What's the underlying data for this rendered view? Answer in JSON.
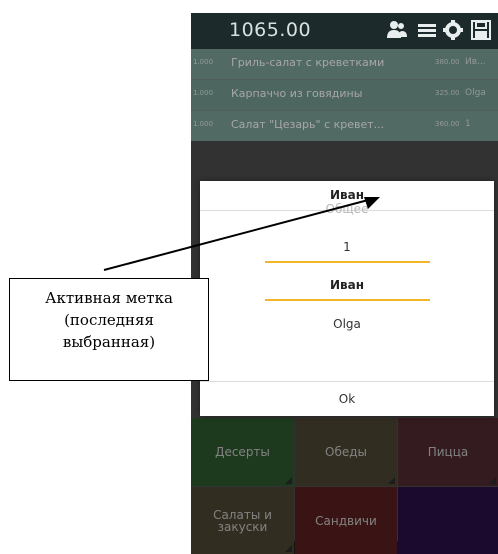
{
  "header": {
    "total": "1065.00",
    "icons": [
      "people-icon",
      "menu-icon",
      "gear-icon",
      "save-icon"
    ]
  },
  "orders": [
    {
      "qty": "1.000",
      "name": "Гриль-салат с креветками",
      "price": "380.00",
      "who": "Ив..."
    },
    {
      "qty": "1.000",
      "name": "Карпаччо из говядины",
      "price": "325.00",
      "who": "Olga"
    },
    {
      "qty": "1.000",
      "name": "Салат \"Цезарь\" с кревет...",
      "price": "360.00",
      "who": "1"
    }
  ],
  "dialog": {
    "title": "Иван",
    "options": [
      "Общее",
      "1",
      "Иван",
      "Olga"
    ],
    "selected": "Иван",
    "ok_label": "Ok"
  },
  "categories": [
    {
      "label": "Десерты",
      "color": "#2e5a2e"
    },
    {
      "label": "Обеды",
      "color": "#4e4533"
    },
    {
      "label": "Пицца",
      "color": "#502a30"
    },
    {
      "label": "Салаты и закуски",
      "color": "#4e4533"
    },
    {
      "label": "Сандвичи",
      "color": "#5a1f1f"
    },
    {
      "label": "",
      "color": "#2a0e48"
    }
  ],
  "annotation": {
    "text_line1": "Активная метка",
    "text_line2": "(последняя",
    "text_line3": "выбранная)"
  },
  "colors": {
    "accent": "#f0b828",
    "order_row": "#637a73",
    "topbar": "#1c2a2c"
  }
}
